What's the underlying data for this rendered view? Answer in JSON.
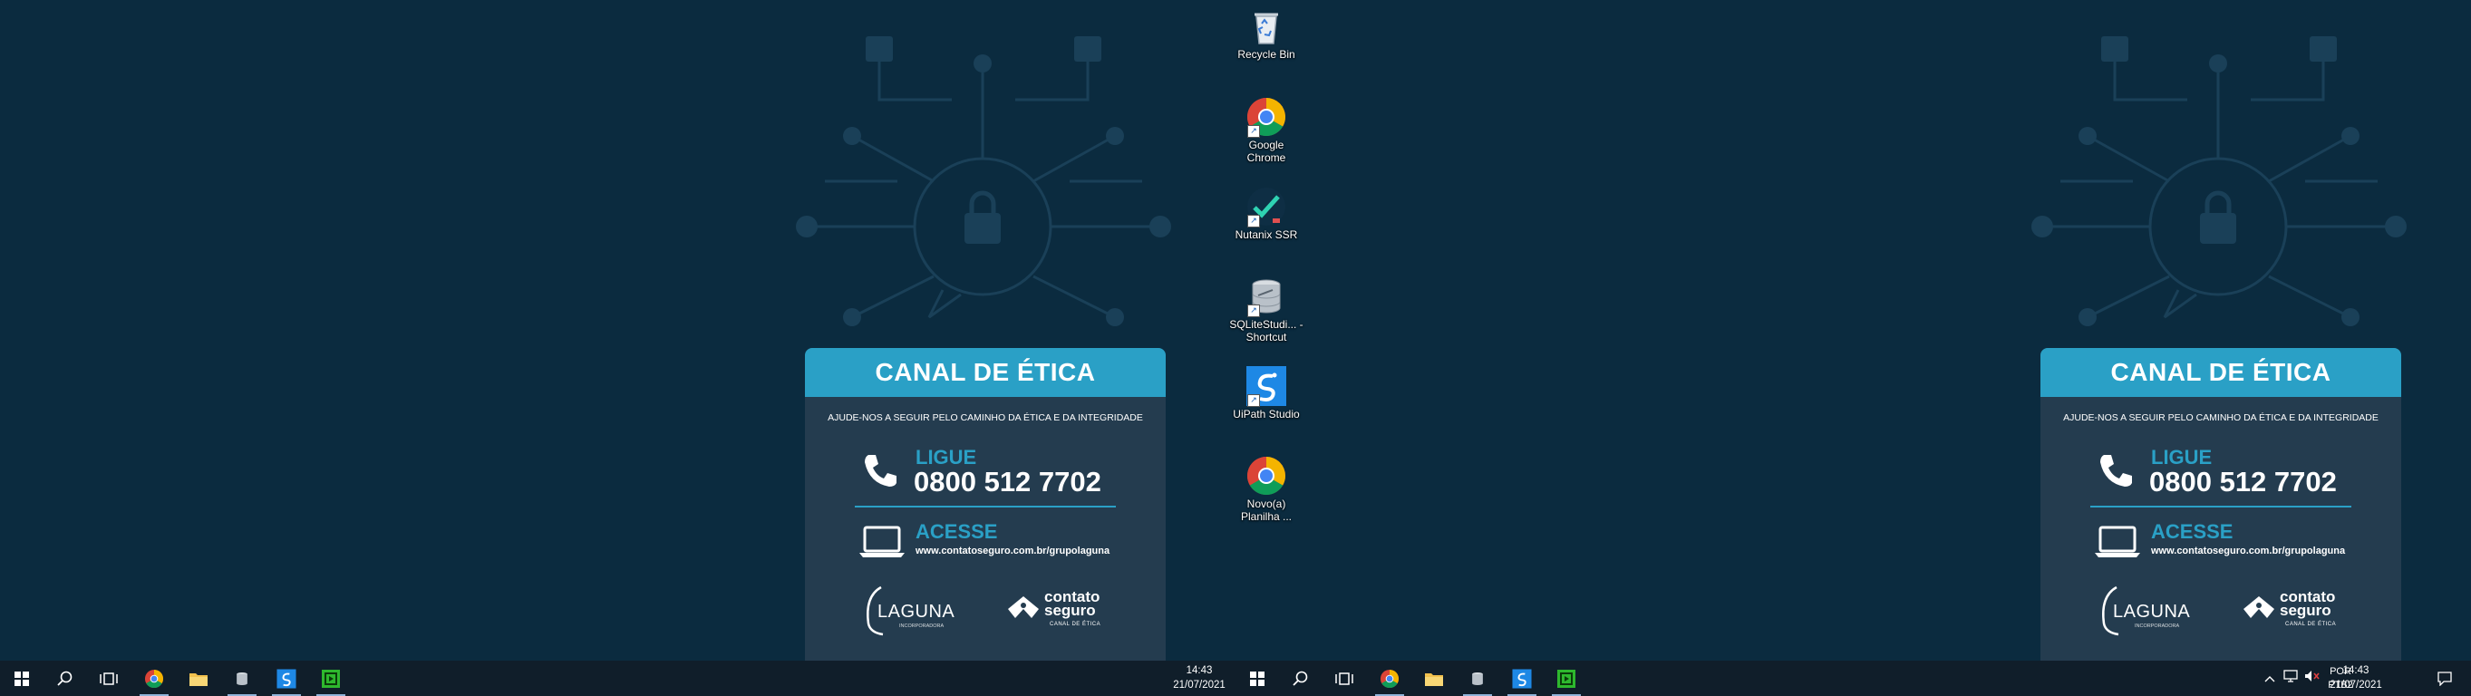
{
  "poster": {
    "title": "CANAL DE ÉTICA",
    "subtitle": "AJUDE-NOS A SEGUIR PELO CAMINHO DA ÉTICA E DA INTEGRIDADE",
    "call_label": "LIGUE",
    "phone": "0800 512 7702",
    "web_label": "ACESSE",
    "url": "www.contatoseguro.com.br/grupolaguna",
    "logo_laguna": "LAGUNA",
    "logo_laguna_tag": "INCORPORADORA",
    "logo_cs_line1": "contato",
    "logo_cs_line2": "seguro",
    "logo_cs_tag": "CANAL DE ÉTICA"
  },
  "desktop_icons": [
    {
      "label": "Recycle Bin",
      "icon": "recycle-bin-icon"
    },
    {
      "label": "Google Chrome",
      "icon": "chrome-icon"
    },
    {
      "label": "Nutanix SSR",
      "icon": "nutanix-icon"
    },
    {
      "label": "SQLiteStudi... - Shortcut",
      "icon": "database-icon"
    },
    {
      "label": "UiPath Studio",
      "icon": "uipath-icon"
    },
    {
      "label": "Novo(a) Planilha ...",
      "icon": "chrome-icon"
    }
  ],
  "taskbar_left": {
    "time": "14:43",
    "date": "21/07/2021"
  },
  "taskbar_right": {
    "time": "14:43",
    "date": "21/07/2021",
    "lang_line1": "POR",
    "lang_line2": "PTB2"
  },
  "colors": {
    "wallpaper": "#0b2b3f",
    "accent": "#2aa0c6",
    "poster_body": "#243c4f",
    "taskbar": "#101e2a"
  }
}
